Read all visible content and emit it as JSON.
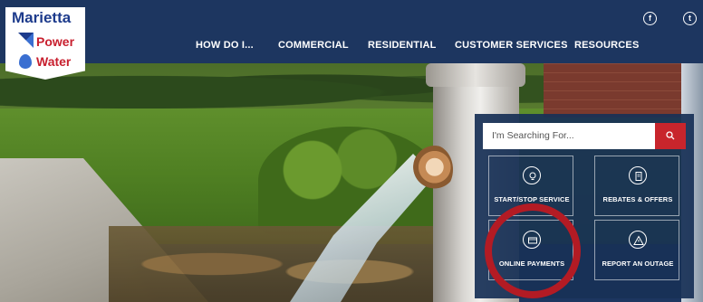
{
  "brand": {
    "line1": "Marietta",
    "line2": "Power",
    "line3": "Water"
  },
  "nav": {
    "items": [
      {
        "label": "HOW DO I..."
      },
      {
        "label": "COMMERCIAL"
      },
      {
        "label": "RESIDENTIAL"
      },
      {
        "label": "CUSTOMER SERVICES"
      },
      {
        "label": "RESOURCES"
      }
    ]
  },
  "social": {
    "facebook_glyph": "f",
    "twitter_glyph": "t",
    "icons": [
      "facebook-icon",
      "twitter-icon"
    ]
  },
  "search": {
    "placeholder": "I'm Searching For...",
    "button_icon": "search-icon"
  },
  "tiles": [
    {
      "label": "START/STOP SERVICE",
      "icon": "lightbulb-icon"
    },
    {
      "label": "REBATES & OFFERS",
      "icon": "receipt-icon"
    },
    {
      "label": "ONLINE PAYMENTS",
      "icon": "payment-card-icon"
    },
    {
      "label": "REPORT AN OUTAGE",
      "icon": "warning-icon"
    }
  ],
  "colors": {
    "nav_bg": "#1d3660",
    "accent_red": "#c8252c",
    "brand_blue": "#1d3b8c",
    "brand_red": "#c8202f",
    "highlight_ring": "#b31b24"
  }
}
